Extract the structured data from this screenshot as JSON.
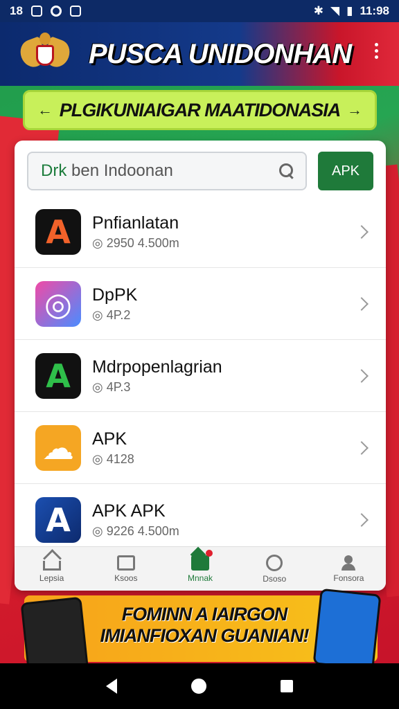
{
  "status_bar": {
    "left_text": "18",
    "time": "11:98"
  },
  "header": {
    "title": "PUSCA UNIDONHAN"
  },
  "banner": {
    "text": "PLGIKUNIAIGAR MAATIDONASIA",
    "left_arrow": "←",
    "right_arrow": "→"
  },
  "search": {
    "value_green": "Drk",
    "value_rest": " ben Indoonan",
    "button_label": "APK"
  },
  "apps": [
    {
      "title": "Pnfianlatan",
      "sub": "◎ 2950  4.500m",
      "glyph": "A",
      "icon": "app-icon-a-orange"
    },
    {
      "title": "DpPK",
      "sub": "◎ 4P.2",
      "glyph": "◎",
      "icon": "app-icon-spiral"
    },
    {
      "title": "Mdrpopenlagrian",
      "sub": "◎ 4P.3",
      "glyph": "A",
      "icon": "app-icon-a-green"
    },
    {
      "title": "APK",
      "sub": "◎ 4128",
      "glyph": "☁",
      "icon": "app-icon-cloud"
    },
    {
      "title": "APK APK",
      "sub": "◎ 9226  4.500m",
      "glyph": "A",
      "icon": "app-icon-a-blue"
    }
  ],
  "bottom_nav": [
    {
      "label": "Lepsia",
      "icon": "home-icon"
    },
    {
      "label": "Ksoos",
      "icon": "image-icon"
    },
    {
      "label": "Mnnak",
      "icon": "store-icon",
      "active": true
    },
    {
      "label": "Dsoso",
      "icon": "compass-icon"
    },
    {
      "label": "Fonsora",
      "icon": "person-icon"
    }
  ],
  "promo": {
    "line1": "FOMINN A IAIRGON",
    "line2": "IMIANFIOXAN GUANIAN!"
  }
}
